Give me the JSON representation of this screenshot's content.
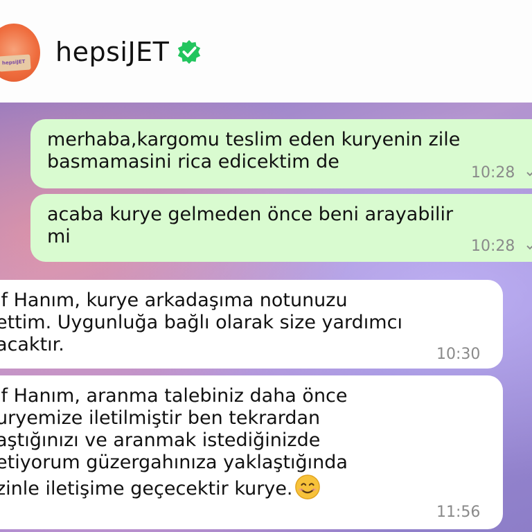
{
  "header": {
    "title": "hepsiJET",
    "verified_icon": "verified-badge-icon",
    "badge_color": "#22c55e"
  },
  "messages": [
    {
      "direction": "outgoing",
      "text": "merhaba,kargomu teslim eden kuryenin zile\nbasmamasini rica edicektim de",
      "time": "10:28"
    },
    {
      "direction": "outgoing",
      "text": "acaba kurye gelmeden önce beni arayabilir\nmi",
      "time": "10:28"
    },
    {
      "direction": "incoming",
      "text": "if Hanım, kurye arkadaşıma notunuzu\nettim. Uygunluğa bağlı olarak size yardımcı\nacaktır.",
      "time": "10:30"
    },
    {
      "direction": "incoming",
      "text": "if Hanım, aranma talebiniz daha önce\nuryemize iletilmiştir ben tekrardan\naştığınızı ve aranmak istediğinizde\netiyorum güzergahınıza yaklaştığında\nzinle iletişime geçecektir kurye.",
      "time": "11:56",
      "emoji": "smiling-face-icon"
    }
  ],
  "colors": {
    "outgoing_bubble": "#d9fbd0",
    "incoming_bubble": "#ffffff",
    "brand": "#ef6d3e"
  }
}
